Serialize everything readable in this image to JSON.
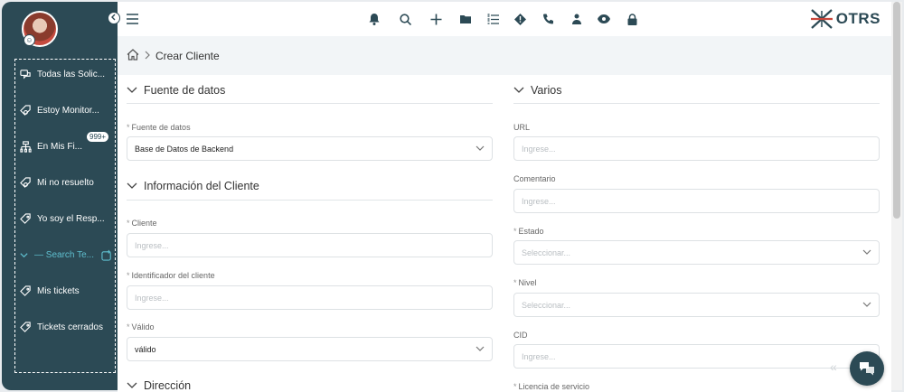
{
  "sidebar": {
    "avatar_badge": "☺",
    "items": [
      {
        "label": "Todas las Solic...",
        "icon": "chat-bubbles-icon"
      },
      {
        "label": "Estoy Monitor...",
        "icon": "tag-eye-icon"
      },
      {
        "label": "En Mis Fi...",
        "icon": "hierarchy-icon",
        "badge": "999+"
      },
      {
        "label": "Mi no resuelto",
        "icon": "tag-eye-icon"
      },
      {
        "label": "Yo soy el Resp...",
        "icon": "tag-icon"
      },
      {
        "label": "— Search Te...",
        "icon": "chevron-down-icon"
      },
      {
        "label": "Mis tickets",
        "icon": "tag-icon"
      },
      {
        "label": "Tickets cerrados",
        "icon": "tag-icon"
      }
    ]
  },
  "topbar": {
    "icons": [
      "bell-icon",
      "search-icon",
      "plus-icon",
      "folder-icon",
      "list-icon",
      "diamond-icon",
      "phone-icon",
      "person-icon",
      "eye-icon",
      "lock-icon"
    ],
    "logo_text": "OTRS"
  },
  "breadcrumb": {
    "current": "Crear Cliente"
  },
  "left": {
    "section1": "Fuente de datos",
    "source_label": "Fuente de datos",
    "source_value": "Base de Datos de Backend",
    "section2": "Información del Cliente",
    "cliente_label": "Cliente",
    "cliente_placeholder": "Ingrese...",
    "id_label": "Identificador del cliente",
    "id_placeholder": "Ingrese...",
    "valido_label": "Válido",
    "valido_value": "válido",
    "section3": "Dirección"
  },
  "right": {
    "section": "Varios",
    "url_label": "URL",
    "url_placeholder": "Ingrese...",
    "comment_label": "Comentario",
    "comment_placeholder": "Ingrese...",
    "estado_label": "Estado",
    "estado_placeholder": "Seleccionar...",
    "nivel_label": "Nivel",
    "nivel_placeholder": "Seleccionar...",
    "cid_label": "CID",
    "cid_placeholder": "Ingrese...",
    "licencia_label": "Licencia de servicio"
  },
  "required_mark": "*",
  "colors": {
    "sidebar": "#2c4a55",
    "accent": "#5fbfcf",
    "background": "#ffffff"
  }
}
